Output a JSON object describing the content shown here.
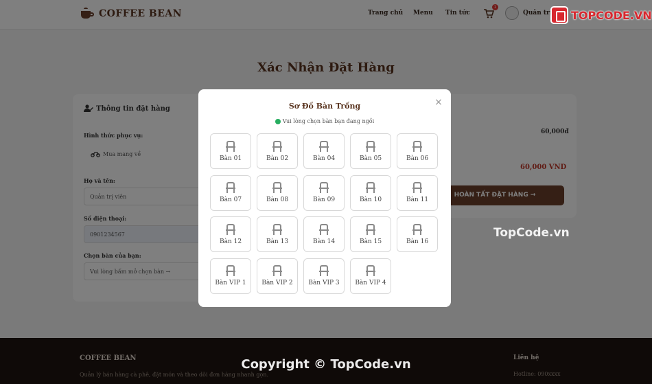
{
  "header": {
    "brand": "COFFEE BEAN",
    "nav": [
      "Trang chủ",
      "Menu",
      "Tin tức"
    ],
    "cart_count": "1",
    "user_name": "Quản trị"
  },
  "page": {
    "title": "Xác Nhận Đặt Hàng"
  },
  "form": {
    "section_title": "Thông tin đặt hàng",
    "service_label": "Hình thức phục vụ:",
    "service_value": "Mua mang về",
    "name_label": "Họ và tên:",
    "name_value": "Quản trị viên",
    "phone_label": "Số điện thoại:",
    "phone_value": "0901234567",
    "table_label": "Chọn bàn của bạn:",
    "table_value": "Vui lòng bấm mở chọn bàn →"
  },
  "summary": {
    "item_price": "60,000đ",
    "total": "60,000 VND",
    "button_label": "HOÀN TẤT ĐẶT HÀNG →"
  },
  "modal": {
    "title": "Sơ Đồ Bàn Trống",
    "hint": "Vui lòng chọn bàn bạn đang ngồi",
    "close": "×",
    "tables": [
      "Bàn 01",
      "Bàn 02",
      "Bàn 04",
      "Bàn 05",
      "Bàn 06",
      "Bàn 07",
      "Bàn 08",
      "Bàn 09",
      "Bàn 10",
      "Bàn 11",
      "Bàn 12",
      "Bàn 13",
      "Bàn 14",
      "Bàn 15",
      "Bàn 16",
      "Bàn VIP 1",
      "Bàn VIP 2",
      "Bàn VIP 3",
      "Bàn VIP 4"
    ]
  },
  "footer": {
    "brand": "COFFEE BEAN",
    "description": "Quản lý bán hàng cà phê, đặt món và theo dõi đơn hàng nhanh gọn.",
    "links_title": "Liên hệ",
    "hotline": "Hotline: 090xxxx"
  },
  "watermarks": {
    "logo_text": "TOPCODE.VN",
    "mid": "TopCode.vn",
    "copyright": "Copyright © TopCode.vn"
  },
  "colors": {
    "brand_brown": "#6b3f2a",
    "available_dot": "#27ae60",
    "price_red": "#c0392b"
  }
}
